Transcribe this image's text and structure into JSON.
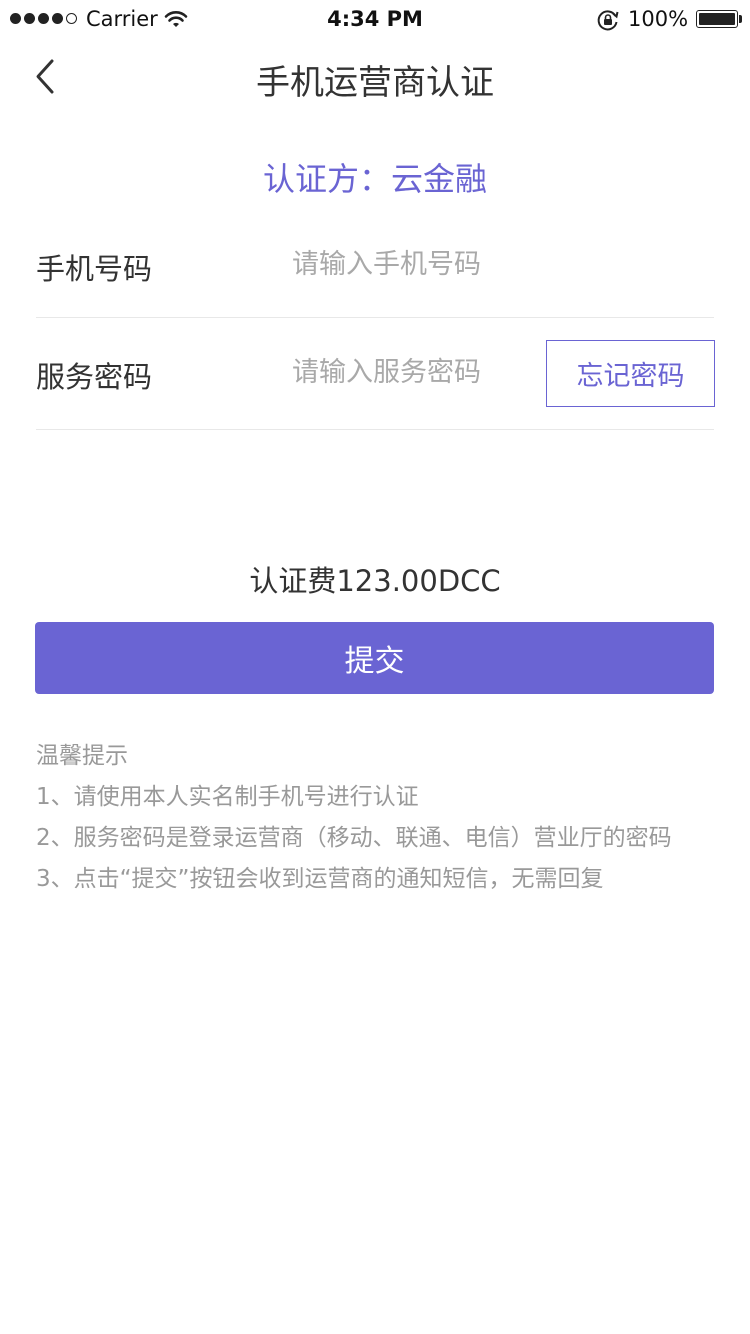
{
  "status_bar": {
    "carrier": "Carrier",
    "time": "4:34 PM",
    "battery": "100%",
    "signal_icon": "signal-dots-icon",
    "wifi_icon": "wifi-icon",
    "lock_icon": "rotation-lock-icon",
    "battery_icon": "battery-icon"
  },
  "nav": {
    "back_icon": "chevron-left-icon",
    "title": "手机运营商认证"
  },
  "authenticator": "认证方：云金融",
  "form": {
    "phone": {
      "label": "手机号码",
      "placeholder": "请输入手机号码",
      "value": ""
    },
    "password": {
      "label": "服务密码",
      "placeholder": "请输入服务密码",
      "value": "",
      "forget_label": "忘记密码"
    }
  },
  "fee": "认证费123.00DCC",
  "submit_label": "提交",
  "tips": {
    "title": "温馨提示",
    "items": [
      "1、请使用本人实名制手机号进行认证",
      "2、服务密码是登录运营商（移动、联通、电信）营业厅的密码",
      "3、点击“提交”按钮会收到运营商的通知短信，无需回复"
    ]
  },
  "colors": {
    "accent": "#6a64d3",
    "text": "#333333",
    "muted": "#999999",
    "placeholder": "#a9a9a9",
    "divider": "#e8e8e8"
  }
}
